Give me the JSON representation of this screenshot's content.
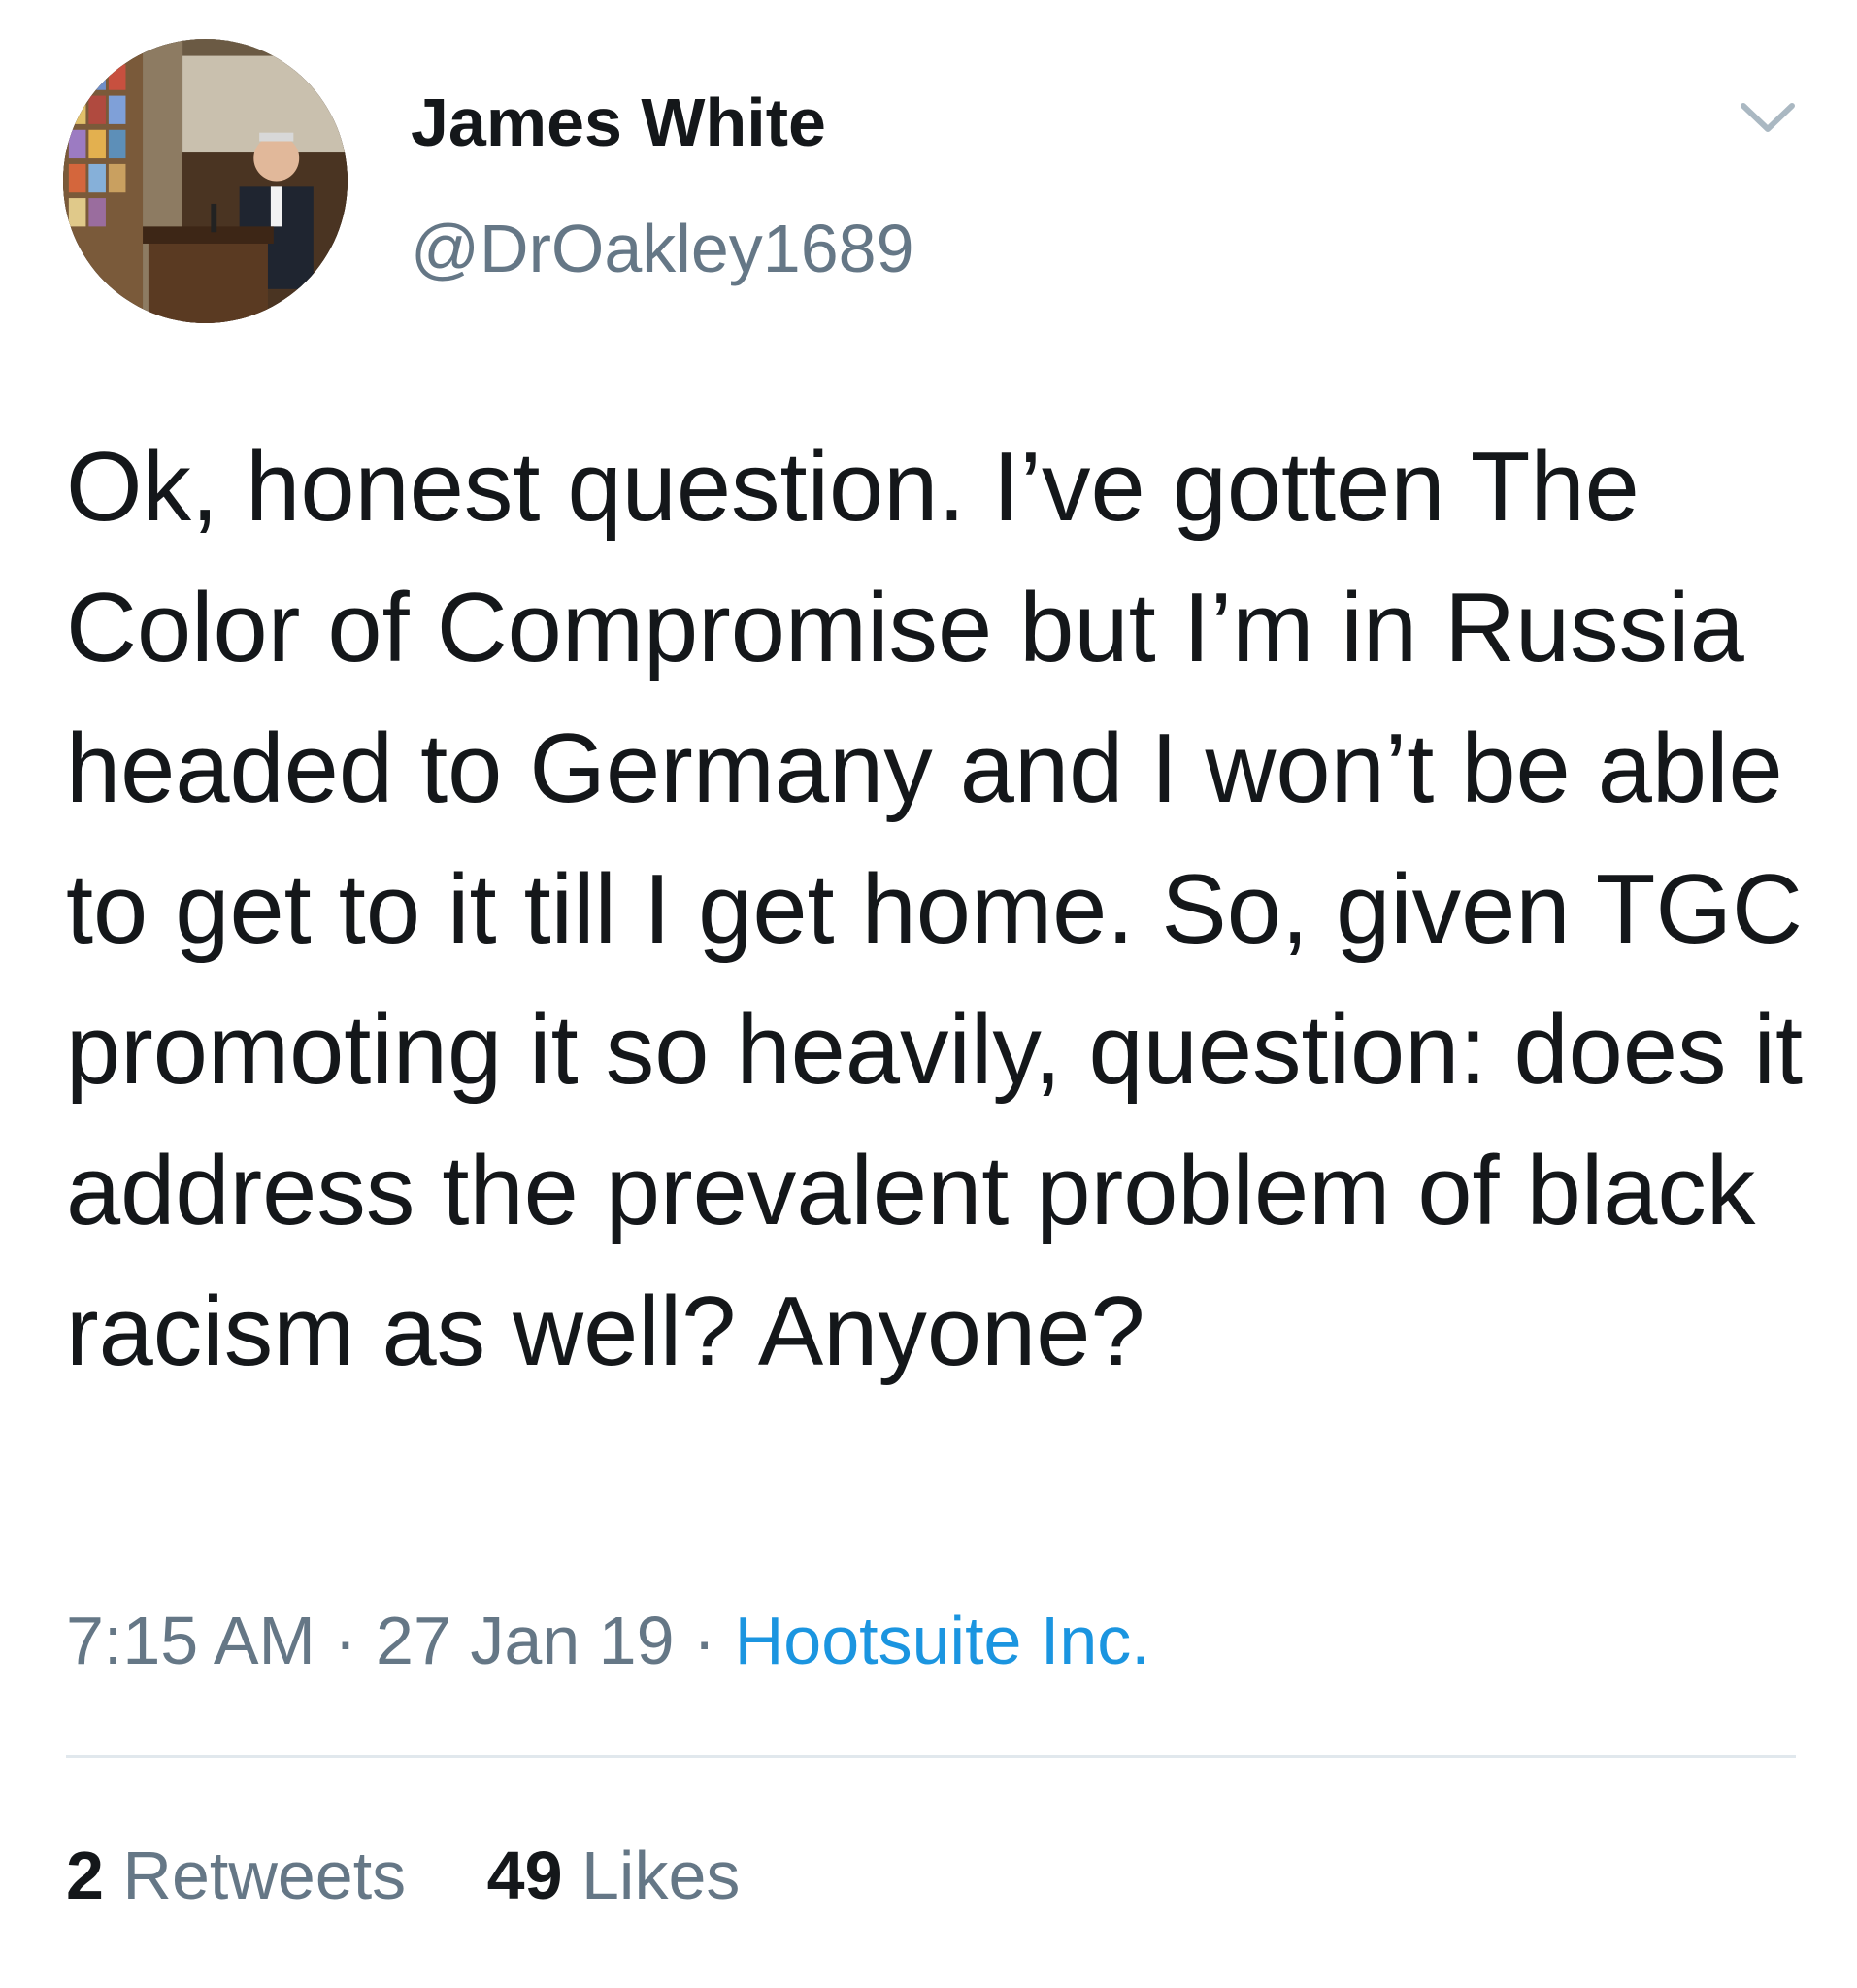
{
  "author": {
    "name": "James White",
    "handle": "@DrOakley1689"
  },
  "tweet": {
    "text": "Ok, honest question. I’ve gotten The Color of Compromise but I’m in Russia headed to Germany and I won’t be able to get to it till I get home. So, given TGC promoting it so heavily, question: does it address the prevalent problem of black racism as well? Anyone?",
    "time": "7:15 AM",
    "separator": "·",
    "date": "27 Jan 19",
    "source": "Hootsuite Inc."
  },
  "stats": {
    "retweets_count": "2",
    "retweets_label": "Retweets",
    "likes_count": "49",
    "likes_label": "Likes"
  },
  "colors": {
    "text": "#14171a",
    "secondary": "#657786",
    "link": "#1b95e0",
    "divider": "#e1e8ed"
  },
  "icons": {
    "menu": "chevron-down-icon"
  }
}
